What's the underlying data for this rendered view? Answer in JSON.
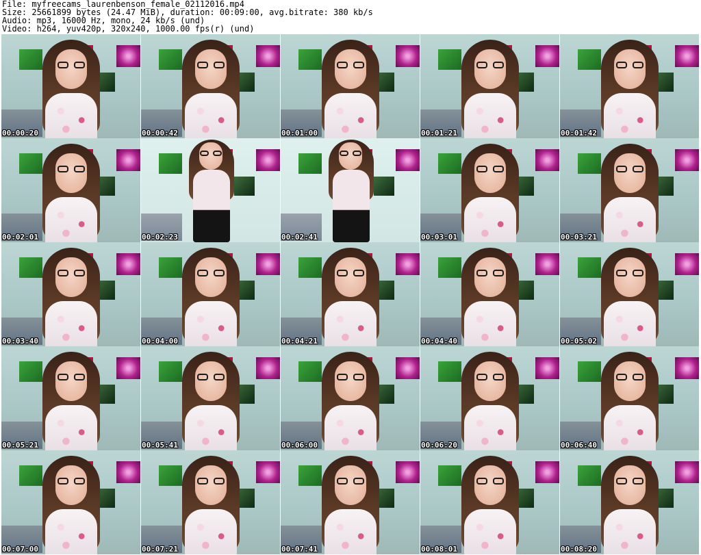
{
  "header": {
    "file": "File: myfreecams_laurenbenson_female_02112016.mp4",
    "size": "Size: 25661899 bytes (24.47 MiB), duration: 00:09:00, avg.bitrate: 380 kb/s",
    "audio": "Audio: mp3, 16000 Hz, mono, 24 kb/s (und)",
    "video": "Video: h264, yuv420p, 320x240, 1000.00 fps(r) (und)"
  },
  "thumbnails": [
    {
      "time": "00:00:20",
      "pose": "sitting"
    },
    {
      "time": "00:00:42",
      "pose": "sitting"
    },
    {
      "time": "00:01:00",
      "pose": "sitting"
    },
    {
      "time": "00:01:21",
      "pose": "sitting"
    },
    {
      "time": "00:01:42",
      "pose": "sitting"
    },
    {
      "time": "00:02:01",
      "pose": "sitting"
    },
    {
      "time": "00:02:23",
      "pose": "standing"
    },
    {
      "time": "00:02:41",
      "pose": "standing"
    },
    {
      "time": "00:03:01",
      "pose": "sitting"
    },
    {
      "time": "00:03:21",
      "pose": "sitting"
    },
    {
      "time": "00:03:40",
      "pose": "sitting"
    },
    {
      "time": "00:04:00",
      "pose": "sitting"
    },
    {
      "time": "00:04:21",
      "pose": "sitting"
    },
    {
      "time": "00:04:40",
      "pose": "sitting"
    },
    {
      "time": "00:05:02",
      "pose": "sitting"
    },
    {
      "time": "00:05:21",
      "pose": "sitting"
    },
    {
      "time": "00:05:41",
      "pose": "sitting"
    },
    {
      "time": "00:06:00",
      "pose": "sitting"
    },
    {
      "time": "00:06:20",
      "pose": "sitting"
    },
    {
      "time": "00:06:40",
      "pose": "sitting"
    },
    {
      "time": "00:07:00",
      "pose": "sitting"
    },
    {
      "time": "00:07:21",
      "pose": "sitting"
    },
    {
      "time": "00:07:41",
      "pose": "sitting"
    },
    {
      "time": "00:08:01",
      "pose": "sitting"
    },
    {
      "time": "00:08:20",
      "pose": "sitting"
    }
  ],
  "colors": {
    "timestamp_text": "#ffffff",
    "timestamp_outline": "#000000",
    "background": "#ffffff"
  }
}
